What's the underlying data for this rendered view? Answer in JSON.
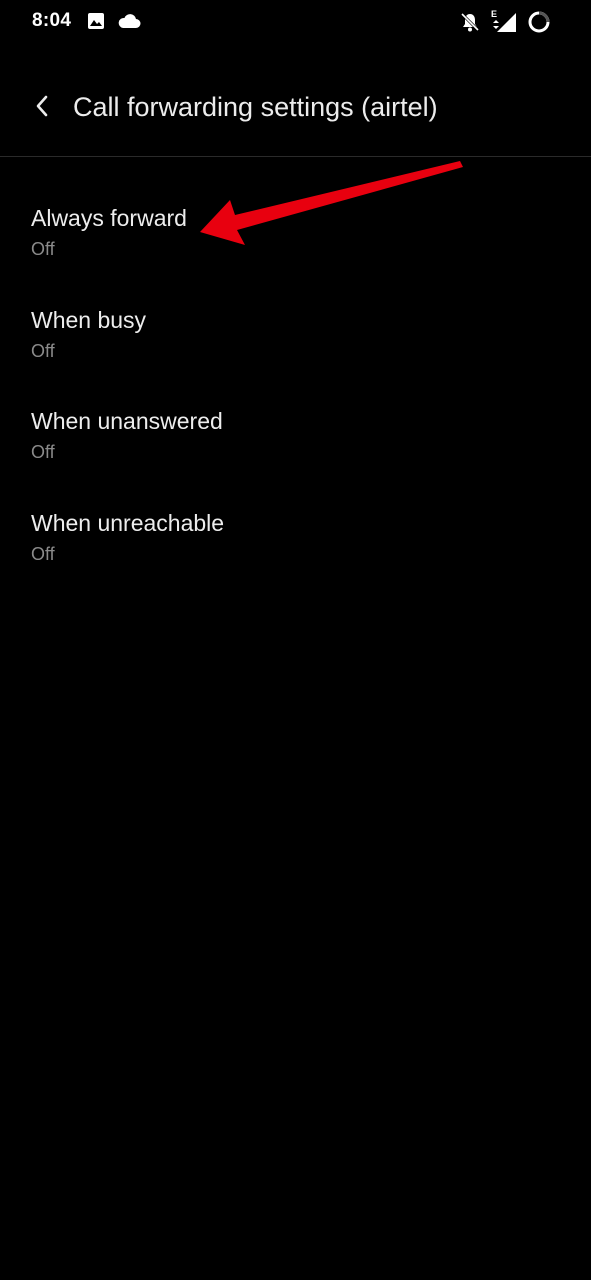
{
  "status_bar": {
    "time": "8:04",
    "network_type": "E",
    "left_icons": [
      "image-icon",
      "cloud-icon"
    ],
    "right_icons": [
      "bell-off-icon",
      "signal-icon",
      "battery-ring-icon"
    ]
  },
  "header": {
    "title": "Call forwarding settings (airtel)"
  },
  "settings": [
    {
      "title": "Always forward",
      "summary": "Off"
    },
    {
      "title": "When busy",
      "summary": "Off"
    },
    {
      "title": "When unanswered",
      "summary": "Off"
    },
    {
      "title": "When unreachable",
      "summary": "Off"
    }
  ],
  "colors": {
    "background": "#000000",
    "title_text": "#ececec",
    "summary_text": "#8a8a8a",
    "annotation_arrow": "#e8000f"
  }
}
